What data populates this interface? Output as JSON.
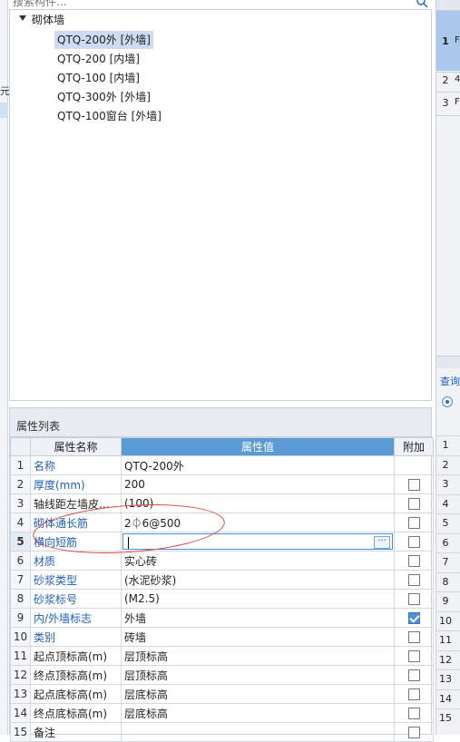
{
  "search": {
    "placeholder": "搜索构件..."
  },
  "left_sliver": {
    "text": "元"
  },
  "tree": {
    "category": "砌体墙",
    "items": [
      {
        "label": "QTQ-200外 [外墙]",
        "selected": true
      },
      {
        "label": "QTQ-200 [内墙]",
        "selected": false
      },
      {
        "label": "QTQ-100 [内墙]",
        "selected": false
      },
      {
        "label": "QTQ-300外 [外墙]",
        "selected": false
      },
      {
        "label": "QTQ-100窗台 [外墙]",
        "selected": false
      }
    ]
  },
  "right_panel": {
    "top_rows": [
      {
        "num": "1",
        "text": "F"
      },
      {
        "num": "2",
        "text": "4"
      },
      {
        "num": "3",
        "text": "F"
      }
    ],
    "query_label": "查询",
    "lower_rows": [
      "1",
      "2",
      "3",
      "4",
      "5",
      "6",
      "7",
      "8",
      "9",
      "10",
      "11",
      "12",
      "13",
      "14",
      "15"
    ]
  },
  "props": {
    "title": "属性列表",
    "headers": {
      "name": "属性名称",
      "value": "属性值",
      "extra": "附加"
    },
    "rows": [
      {
        "num": "1",
        "name": "名称",
        "value": "QTQ-200外",
        "blue": true,
        "has_checkbox": false,
        "checked": false
      },
      {
        "num": "2",
        "name": "厚度(mm)",
        "value": "200",
        "blue": true,
        "has_checkbox": true,
        "checked": false
      },
      {
        "num": "3",
        "name": "轴线距左墙皮...",
        "value": "(100)",
        "blue": false,
        "has_checkbox": true,
        "checked": false
      },
      {
        "num": "4",
        "name": "砌体通长筋",
        "value": "2⏀6@500",
        "blue": true,
        "has_checkbox": true,
        "checked": false
      },
      {
        "num": "5",
        "name": "横向短筋",
        "value": "",
        "blue": true,
        "has_checkbox": true,
        "checked": false,
        "editing": true
      },
      {
        "num": "6",
        "name": "材质",
        "value": "实心砖",
        "blue": true,
        "has_checkbox": true,
        "checked": false
      },
      {
        "num": "7",
        "name": "砂浆类型",
        "value": "(水泥砂浆)",
        "blue": true,
        "has_checkbox": true,
        "checked": false
      },
      {
        "num": "8",
        "name": "砂浆标号",
        "value": "(M2.5)",
        "blue": true,
        "has_checkbox": true,
        "checked": false
      },
      {
        "num": "9",
        "name": "内/外墙标志",
        "value": "外墙",
        "blue": true,
        "has_checkbox": true,
        "checked": true
      },
      {
        "num": "10",
        "name": "类别",
        "value": "砖墙",
        "blue": true,
        "has_checkbox": true,
        "checked": false
      },
      {
        "num": "11",
        "name": "起点顶标高(m)",
        "value": "层顶标高",
        "blue": false,
        "has_checkbox": true,
        "checked": false
      },
      {
        "num": "12",
        "name": "终点顶标高(m)",
        "value": "层顶标高",
        "blue": false,
        "has_checkbox": true,
        "checked": false
      },
      {
        "num": "13",
        "name": "起点底标高(m)",
        "value": "层底标高",
        "blue": false,
        "has_checkbox": true,
        "checked": false
      },
      {
        "num": "14",
        "name": "终点底标高(m)",
        "value": "层底标高",
        "blue": false,
        "has_checkbox": true,
        "checked": false
      },
      {
        "num": "15",
        "name": "备注",
        "value": "",
        "blue": false,
        "has_checkbox": true,
        "checked": false
      }
    ],
    "ellipsis_label": "···"
  },
  "colors": {
    "accent": "#5b9bd5",
    "link_blue": "#1f5fbf",
    "annotation": "#e0433a",
    "selection": "#cddcf0"
  }
}
